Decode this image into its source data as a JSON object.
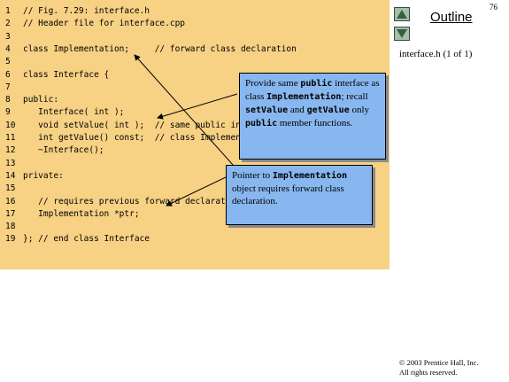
{
  "page_number": "76",
  "outline": {
    "title": "Outline",
    "file_label": "interface.h (1 of 1)"
  },
  "code_lines": [
    {
      "num": "1",
      "text": "// Fig. 7.29: interface.h"
    },
    {
      "num": "2",
      "text": "// Header file for interface.cpp"
    },
    {
      "num": "3",
      "text": ""
    },
    {
      "num": "4",
      "text": "class Implementation;     // forward class declaration"
    },
    {
      "num": "5",
      "text": ""
    },
    {
      "num": "6",
      "text": "class Interface {"
    },
    {
      "num": "7",
      "text": ""
    },
    {
      "num": "8",
      "text": "public:"
    },
    {
      "num": "9",
      "text": "   Interface( int );"
    },
    {
      "num": "10",
      "text": "   void setValue( int );  // same public interface as"
    },
    {
      "num": "11",
      "text": "   int getValue() const;  // class Implementation"
    },
    {
      "num": "12",
      "text": "   ~Interface();"
    },
    {
      "num": "13",
      "text": ""
    },
    {
      "num": "14",
      "text": "private:"
    },
    {
      "num": "15",
      "text": ""
    },
    {
      "num": "16",
      "text": "   // requires previous forward declaration (line 4)"
    },
    {
      "num": "17",
      "text": "   Implementation *ptr;"
    },
    {
      "num": "18",
      "text": ""
    },
    {
      "num": "19",
      "text": "}; // end class Interface"
    }
  ],
  "callout_1": {
    "p1": "Provide same ",
    "m1": "public",
    "p2": " interface as class ",
    "m2": "Implementation",
    "p3": "; recall ",
    "m3": "setValue",
    "p4": " and ",
    "m4": "getValue",
    "p5": " only ",
    "m5": "public",
    "p6": " member functions."
  },
  "callout_2": {
    "p1": "Pointer to ",
    "m1": "Implementation",
    "p2": " object requires forward class declaration."
  },
  "copyright": {
    "line1": "© 2003 Prentice Hall, Inc.",
    "line2": "All rights reserved."
  },
  "colors": {
    "code_background": "#f7d184",
    "callout_background": "#88b7f0",
    "nav_button": "#9ec3a8"
  },
  "icons": [
    "up-arrow-icon",
    "down-arrow-icon"
  ]
}
